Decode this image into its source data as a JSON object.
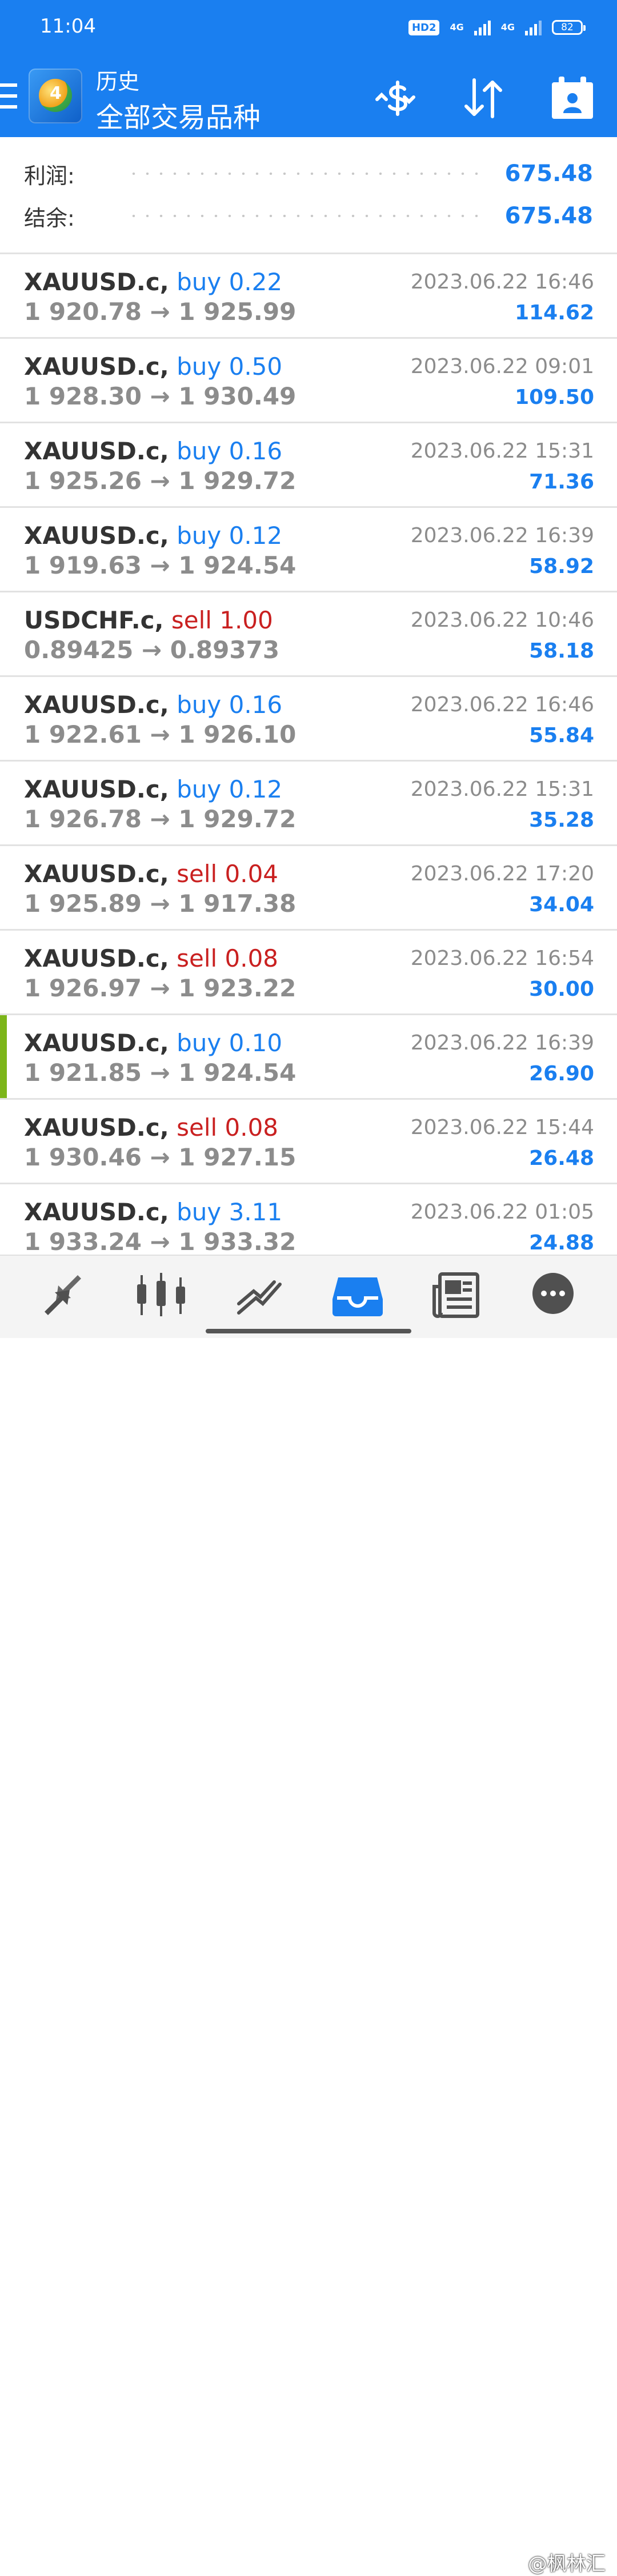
{
  "status_bar": {
    "time": "11:04",
    "hd": "HD2",
    "net1": "4G",
    "net2": "4G",
    "battery": "82"
  },
  "header": {
    "subtitle": "历史",
    "title": "全部交易品种",
    "logo_number": "4"
  },
  "summary": {
    "profit_label": "利润:",
    "profit_value": "675.48",
    "balance_label": "结余:",
    "balance_value": "675.48"
  },
  "deals": [
    {
      "symbol": "XAUUSD.c,",
      "side": "buy",
      "volume": "0.22",
      "open": "1 920.78",
      "close": "1 925.99",
      "date": "2023.06.22 16:46",
      "profit": "114.62"
    },
    {
      "symbol": "XAUUSD.c,",
      "side": "buy",
      "volume": "0.50",
      "open": "1 928.30",
      "close": "1 930.49",
      "date": "2023.06.22 09:01",
      "profit": "109.50"
    },
    {
      "symbol": "XAUUSD.c,",
      "side": "buy",
      "volume": "0.16",
      "open": "1 925.26",
      "close": "1 929.72",
      "date": "2023.06.22 15:31",
      "profit": "71.36"
    },
    {
      "symbol": "XAUUSD.c,",
      "side": "buy",
      "volume": "0.12",
      "open": "1 919.63",
      "close": "1 924.54",
      "date": "2023.06.22 16:39",
      "profit": "58.92"
    },
    {
      "symbol": "USDCHF.c,",
      "side": "sell",
      "volume": "1.00",
      "open": "0.89425",
      "close": "0.89373",
      "date": "2023.06.22 10:46",
      "profit": "58.18"
    },
    {
      "symbol": "XAUUSD.c,",
      "side": "buy",
      "volume": "0.16",
      "open": "1 922.61",
      "close": "1 926.10",
      "date": "2023.06.22 16:46",
      "profit": "55.84"
    },
    {
      "symbol": "XAUUSD.c,",
      "side": "buy",
      "volume": "0.12",
      "open": "1 926.78",
      "close": "1 929.72",
      "date": "2023.06.22 15:31",
      "profit": "35.28"
    },
    {
      "symbol": "XAUUSD.c,",
      "side": "sell",
      "volume": "0.04",
      "open": "1 925.89",
      "close": "1 917.38",
      "date": "2023.06.22 17:20",
      "profit": "34.04"
    },
    {
      "symbol": "XAUUSD.c,",
      "side": "sell",
      "volume": "0.08",
      "open": "1 926.97",
      "close": "1 923.22",
      "date": "2023.06.22 16:54",
      "profit": "30.00"
    },
    {
      "symbol": "XAUUSD.c,",
      "side": "buy",
      "volume": "0.10",
      "open": "1 921.85",
      "close": "1 924.54",
      "date": "2023.06.22 16:39",
      "profit": "26.90",
      "marked": true
    },
    {
      "symbol": "XAUUSD.c,",
      "side": "sell",
      "volume": "0.08",
      "open": "1 930.46",
      "close": "1 927.15",
      "date": "2023.06.22 15:44",
      "profit": "26.48"
    },
    {
      "symbol": "XAUUSD.c,",
      "side": "buy",
      "volume": "3.11",
      "open": "1 933.24",
      "close": "1 933.32",
      "date": "2023.06.22 01:05",
      "profit": "24.88"
    }
  ],
  "arrow_glyph": "→",
  "bottom_nav": [
    "quotes",
    "chart",
    "trade",
    "history",
    "news",
    "messages"
  ],
  "watermark": "@枫林汇",
  "colors": {
    "accent": "#1a7ff0",
    "buy": "#1a7ff0",
    "sell": "#c92020",
    "marker": "#7cb51a"
  }
}
